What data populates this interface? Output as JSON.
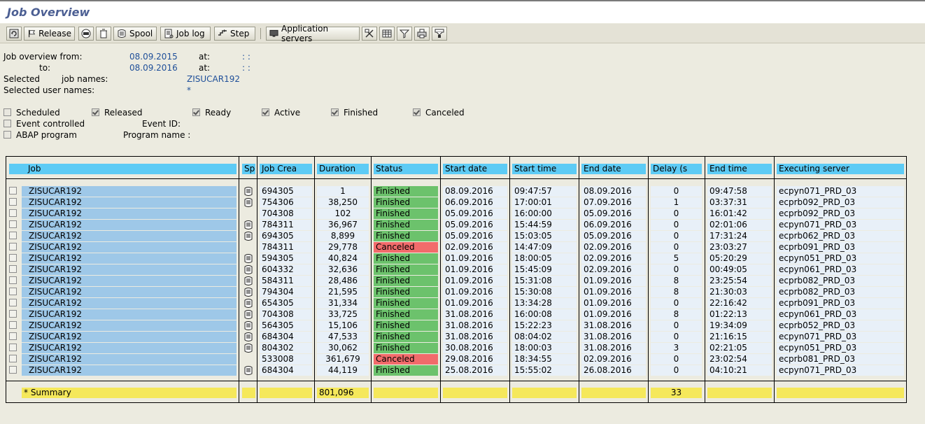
{
  "window": {
    "title": "Job Overview"
  },
  "toolbar": {
    "release_label": "Release",
    "spool_label": "Spool",
    "joblog_label": "Job log",
    "step_label": "Step",
    "appservers_label": "Application servers"
  },
  "header": {
    "from_label": "Job overview from:",
    "from_date": "08.09.2015",
    "from_at_label": "at:",
    "from_time": ": :",
    "to_label": "to:",
    "to_date": "08.09.2016",
    "to_at_label": "at:",
    "to_time": ": :",
    "selected_label": "Selected",
    "jobnames_label": "job names:",
    "jobnames_value": "ZISUCAR192",
    "usernames_label": "Selected user names:",
    "usernames_value": "*"
  },
  "filters": {
    "scheduled": {
      "label": "Scheduled",
      "checked": false
    },
    "released": {
      "label": "Released",
      "checked": true
    },
    "ready": {
      "label": "Ready",
      "checked": true
    },
    "active": {
      "label": "Active",
      "checked": true
    },
    "finished": {
      "label": "Finished",
      "checked": true
    },
    "canceled": {
      "label": "Canceled",
      "checked": true
    },
    "event_controlled": {
      "label": "Event controlled",
      "checked": false
    },
    "event_id_label": "Event ID:",
    "abap_program": {
      "label": "ABAP program",
      "checked": false
    },
    "program_name_label": "Program name :"
  },
  "table": {
    "columns": [
      "Job",
      "Sp",
      "Job Crea",
      "Duration",
      "Status",
      "Start date",
      "Start time",
      "End date",
      "Delay (s",
      "End time",
      "Executing server"
    ],
    "rows": [
      {
        "job": "ZISUCAR192",
        "spool": true,
        "creator": "694305",
        "duration": "1",
        "status": "Finished",
        "start_date": "08.09.2016",
        "start_time": "09:47:57",
        "end_date": "08.09.2016",
        "delay": "0",
        "end_time": "09:47:58",
        "server": "ecpyn071_PRD_03"
      },
      {
        "job": "ZISUCAR192",
        "spool": true,
        "creator": "754306",
        "duration": "38,250",
        "status": "Finished",
        "start_date": "06.09.2016",
        "start_time": "17:00:01",
        "end_date": "07.09.2016",
        "delay": "1",
        "end_time": "03:37:31",
        "server": "ecprb092_PRD_03"
      },
      {
        "job": "ZISUCAR192",
        "spool": false,
        "creator": "704308",
        "duration": "102",
        "status": "Finished",
        "start_date": "05.09.2016",
        "start_time": "16:00:00",
        "end_date": "05.09.2016",
        "delay": "0",
        "end_time": "16:01:42",
        "server": "ecprb092_PRD_03"
      },
      {
        "job": "ZISUCAR192",
        "spool": true,
        "creator": "784311",
        "duration": "36,967",
        "status": "Finished",
        "start_date": "05.09.2016",
        "start_time": "15:44:59",
        "end_date": "06.09.2016",
        "delay": "0",
        "end_time": "02:01:06",
        "server": "ecpyn071_PRD_03"
      },
      {
        "job": "ZISUCAR192",
        "spool": true,
        "creator": "694305",
        "duration": "8,899",
        "status": "Finished",
        "start_date": "05.09.2016",
        "start_time": "15:03:05",
        "end_date": "05.09.2016",
        "delay": "0",
        "end_time": "17:31:24",
        "server": "ecprb062_PRD_03"
      },
      {
        "job": "ZISUCAR192",
        "spool": false,
        "creator": "784311",
        "duration": "29,778",
        "status": "Canceled",
        "start_date": "02.09.2016",
        "start_time": "14:47:09",
        "end_date": "02.09.2016",
        "delay": "0",
        "end_time": "23:03:27",
        "server": "ecprb091_PRD_03"
      },
      {
        "job": "ZISUCAR192",
        "spool": true,
        "creator": "594305",
        "duration": "40,824",
        "status": "Finished",
        "start_date": "01.09.2016",
        "start_time": "18:00:05",
        "end_date": "02.09.2016",
        "delay": "5",
        "end_time": "05:20:29",
        "server": "ecpyn051_PRD_03"
      },
      {
        "job": "ZISUCAR192",
        "spool": true,
        "creator": "604332",
        "duration": "32,636",
        "status": "Finished",
        "start_date": "01.09.2016",
        "start_time": "15:45:09",
        "end_date": "02.09.2016",
        "delay": "0",
        "end_time": "00:49:05",
        "server": "ecpyn061_PRD_03"
      },
      {
        "job": "ZISUCAR192",
        "spool": true,
        "creator": "584311",
        "duration": "28,486",
        "status": "Finished",
        "start_date": "01.09.2016",
        "start_time": "15:31:08",
        "end_date": "01.09.2016",
        "delay": "8",
        "end_time": "23:25:54",
        "server": "ecprb082_PRD_03"
      },
      {
        "job": "ZISUCAR192",
        "spool": true,
        "creator": "794304",
        "duration": "21,595",
        "status": "Finished",
        "start_date": "01.09.2016",
        "start_time": "15:30:08",
        "end_date": "01.09.2016",
        "delay": "8",
        "end_time": "21:30:03",
        "server": "ecprb082_PRD_03"
      },
      {
        "job": "ZISUCAR192",
        "spool": true,
        "creator": "654305",
        "duration": "31,334",
        "status": "Finished",
        "start_date": "01.09.2016",
        "start_time": "13:34:28",
        "end_date": "01.09.2016",
        "delay": "0",
        "end_time": "22:16:42",
        "server": "ecprb091_PRD_03"
      },
      {
        "job": "ZISUCAR192",
        "spool": true,
        "creator": "704308",
        "duration": "33,725",
        "status": "Finished",
        "start_date": "31.08.2016",
        "start_time": "16:00:08",
        "end_date": "01.09.2016",
        "delay": "8",
        "end_time": "01:22:13",
        "server": "ecpyn061_PRD_03"
      },
      {
        "job": "ZISUCAR192",
        "spool": true,
        "creator": "564305",
        "duration": "15,106",
        "status": "Finished",
        "start_date": "31.08.2016",
        "start_time": "15:22:23",
        "end_date": "31.08.2016",
        "delay": "0",
        "end_time": "19:34:09",
        "server": "ecprb052_PRD_03"
      },
      {
        "job": "ZISUCAR192",
        "spool": true,
        "creator": "684304",
        "duration": "47,533",
        "status": "Finished",
        "start_date": "31.08.2016",
        "start_time": "08:04:02",
        "end_date": "31.08.2016",
        "delay": "0",
        "end_time": "21:16:15",
        "server": "ecpyn071_PRD_03"
      },
      {
        "job": "ZISUCAR192",
        "spool": true,
        "creator": "804302",
        "duration": "30,062",
        "status": "Finished",
        "start_date": "30.08.2016",
        "start_time": "18:00:03",
        "end_date": "31.08.2016",
        "delay": "3",
        "end_time": "02:21:05",
        "server": "ecpyn051_PRD_03"
      },
      {
        "job": "ZISUCAR192",
        "spool": false,
        "creator": "533008",
        "duration": "361,679",
        "status": "Canceled",
        "start_date": "29.08.2016",
        "start_time": "18:34:55",
        "end_date": "02.09.2016",
        "delay": "0",
        "end_time": "23:02:54",
        "server": "ecprb081_PRD_03"
      },
      {
        "job": "ZISUCAR192",
        "spool": true,
        "creator": "684304",
        "duration": "44,119",
        "status": "Finished",
        "start_date": "25.08.2016",
        "start_time": "15:55:02",
        "end_date": "26.08.2016",
        "delay": "0",
        "end_time": "04:10:21",
        "server": "ecpyn071_PRD_03"
      }
    ],
    "summary": {
      "label": "* Summary",
      "duration": "801,096",
      "delay": "33"
    }
  },
  "colors": {
    "finished": "#6cc26c",
    "canceled": "#f26b6b",
    "header": "#5dcbf5",
    "summary": "#f5e85b",
    "job_cell": "#9ec8e8"
  }
}
